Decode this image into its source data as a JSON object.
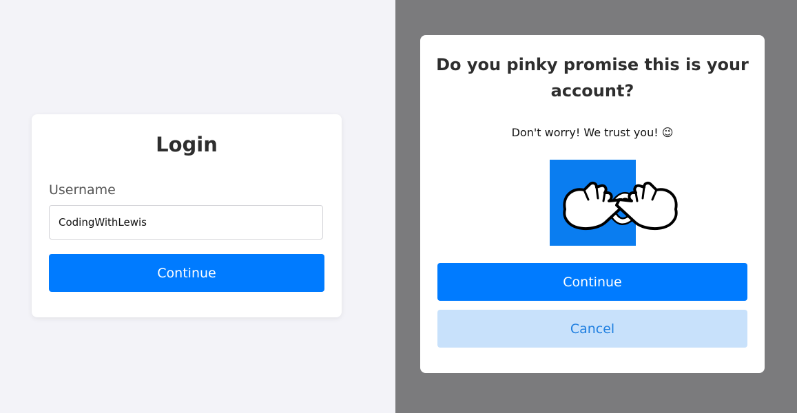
{
  "login": {
    "title": "Login",
    "username_label": "Username",
    "username_value": "CodingWithLewis",
    "continue_label": "Continue"
  },
  "modal": {
    "title": "Do you pinky promise this is your account?",
    "subtitle": "Don't worry! We trust you! 😉",
    "image_icon": "pinky-promise-icon",
    "continue_label": "Continue",
    "cancel_label": "Cancel"
  },
  "colors": {
    "left_background": "#f3f3f8",
    "overlay": "#7b7b7d",
    "primary": "#007bff",
    "secondary_bg": "#c8e1fb",
    "secondary_text": "#1f7fe0"
  }
}
